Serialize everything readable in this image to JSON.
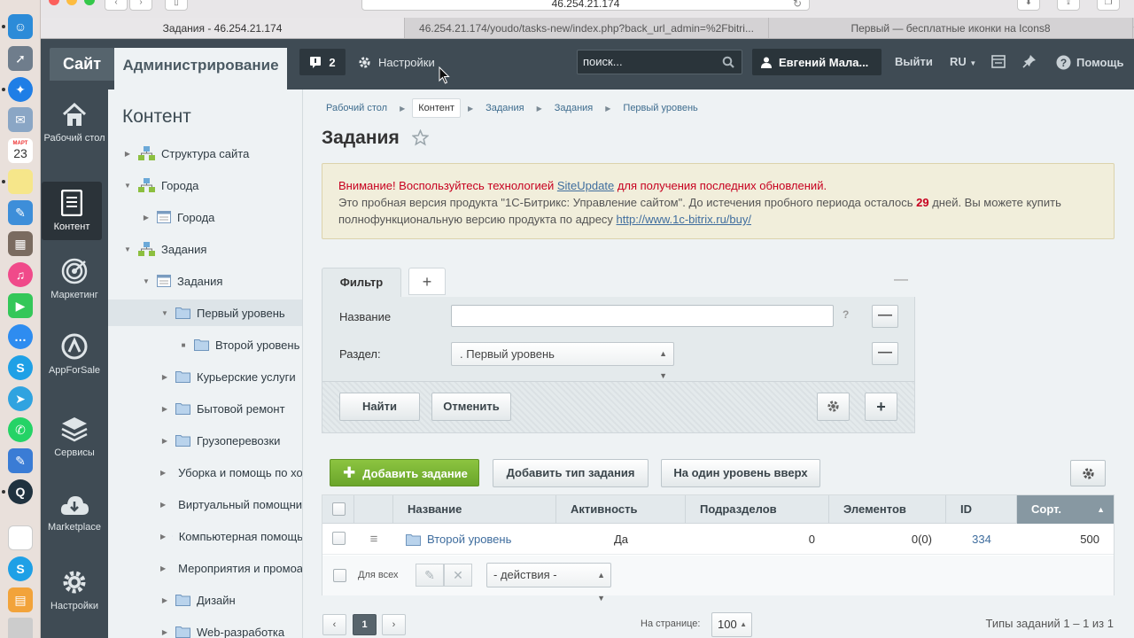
{
  "browser": {
    "url": "46.254.21.174",
    "tabs": [
      {
        "title": "Задания - 46.254.21.174"
      },
      {
        "title": "46.254.21.174/youdo/tasks-new/index.php?back_url_admin=%2Fbitri..."
      },
      {
        "title": "Первый — бесплатные иконки на Icons8"
      }
    ],
    "new_tab": "+"
  },
  "dock": {
    "calendar_month": "МАРТ",
    "calendar_day": "23"
  },
  "top_panel": {
    "site": "Сайт",
    "admin": "Администрирование",
    "notifications_count": "2",
    "settings": "Настройки",
    "search_placeholder": "поиск...",
    "user": "Евгений Мала...",
    "logout": "Выйти",
    "lang": "RU",
    "help": "Помощь"
  },
  "left_rail": [
    {
      "label": "Рабочий стол",
      "icon": "home-icon"
    },
    {
      "label": "Контент",
      "icon": "document-icon"
    },
    {
      "label": "Маркетинг",
      "icon": "target-icon"
    },
    {
      "label": "AppForSale",
      "icon": "appforsale-icon"
    },
    {
      "label": "Сервисы",
      "icon": "layers-icon"
    },
    {
      "label": "Marketplace",
      "icon": "cloud-download-icon"
    },
    {
      "label": "Настройки",
      "icon": "gear-icon"
    }
  ],
  "tree": {
    "title": "Контент",
    "items": [
      {
        "label": "Структура сайта"
      },
      {
        "label": "Города"
      },
      {
        "label": "Города"
      },
      {
        "label": "Задания"
      },
      {
        "label": "Задания"
      },
      {
        "label": "Первый уровень"
      },
      {
        "label": "Второй уровень"
      },
      {
        "label": "Курьерские услуги"
      },
      {
        "label": "Бытовой ремонт"
      },
      {
        "label": "Грузоперевозки"
      },
      {
        "label": "Уборка и помощь по хозяйству"
      },
      {
        "label": "Виртуальный помощник"
      },
      {
        "label": "Компьютерная помощь"
      },
      {
        "label": "Мероприятия и промоакции"
      },
      {
        "label": "Дизайн"
      },
      {
        "label": "Web-разработка"
      }
    ]
  },
  "breadcrumbs": [
    "Рабочий стол",
    "Контент",
    "Задания",
    "Задания",
    "Первый уровень"
  ],
  "page_title": "Задания",
  "alert": {
    "line1_prefix": "Внимание! Воспользуйтесь технологией ",
    "line1_link": "SiteUpdate",
    "line1_suffix": " для получения последних обновлений.",
    "line2_prefix": "Это пробная версия продукта \"1С-Битрикс: Управление сайтом\". До истечения пробного периода осталось ",
    "days": "29",
    "line2_suffix": " дней. Вы можете купить полнофункциональную версию продукта по адресу ",
    "link": "http://www.1c-bitrix.ru/buy/"
  },
  "filter": {
    "tab": "Фильтр",
    "add_tab": "+",
    "collapse": "—",
    "name_label": "Название",
    "name_value": "",
    "help": "?",
    "section_label": "Раздел:",
    "section_value": ". Первый уровень",
    "find": "Найти",
    "cancel": "Отменить",
    "minus": "—",
    "plus": "+"
  },
  "toolbar": {
    "add_task": "Добавить задание",
    "add_task_type": "Добавить тип задания",
    "level_up": "На один уровень вверх"
  },
  "grid": {
    "columns": [
      "Название",
      "Активность",
      "Подразделов",
      "Элементов",
      "ID",
      "Сорт."
    ],
    "rows": [
      {
        "name": "Второй уровень",
        "active": "Да",
        "subsections": "0",
        "elements": "0(0)",
        "id": "334",
        "sort": "500"
      }
    ],
    "for_all": "Для всех",
    "actions": "- действия -"
  },
  "pagination": {
    "current_page": "1",
    "per_page_label": "На странице:",
    "per_page": "100",
    "total": "Типы заданий 1 – 1 из 1"
  },
  "colors": {
    "panel": "#3f4b54",
    "accent_green": "#6aa52b",
    "warning_red": "#c7001f",
    "link": "#3f6d8f"
  }
}
